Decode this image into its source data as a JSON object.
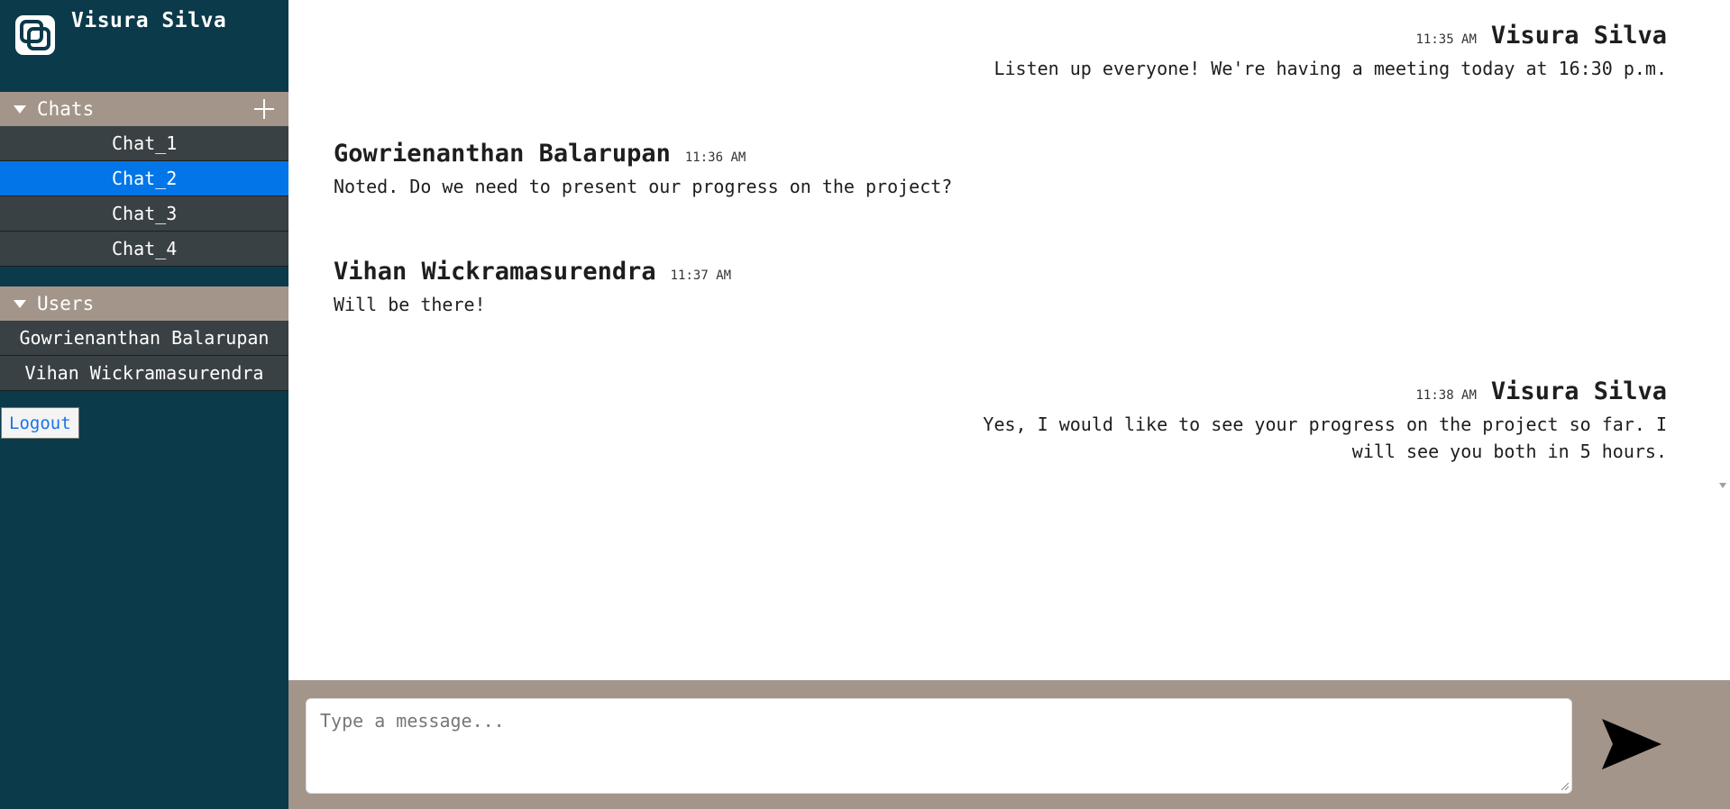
{
  "sidebar": {
    "username": "Visura Silva",
    "chats_header": "Chats",
    "chats": [
      {
        "label": "Chat_1"
      },
      {
        "label": "Chat_2",
        "active": true
      },
      {
        "label": "Chat_3"
      },
      {
        "label": "Chat_4"
      }
    ],
    "users_header": "Users",
    "users": [
      {
        "label": "Gowrienanthan Balarupan"
      },
      {
        "label": "Vihan Wickramasurendra"
      }
    ],
    "logout_label": "Logout"
  },
  "messages": [
    {
      "sender": "Visura Silva",
      "time": "11:35 AM",
      "text": "Listen up everyone! We're having a meeting today at 16:30 p.m.",
      "align": "right"
    },
    {
      "sender": "Gowrienanthan Balarupan",
      "time": "11:36 AM",
      "text": "Noted. Do we need to present our progress on the project?",
      "align": "left"
    },
    {
      "sender": "Vihan Wickramasurendra",
      "time": "11:37 AM",
      "text": "Will be there!",
      "align": "left"
    },
    {
      "sender": "Visura Silva",
      "time": "11:38 AM",
      "text": "Yes, I would like to see your progress on the project so far. I will see you both in 5 hours.",
      "align": "right"
    }
  ],
  "composer": {
    "placeholder": "Type a message...",
    "value": ""
  },
  "icons": {
    "logo": "app-logo-icon",
    "add": "plus-icon",
    "send": "send-icon",
    "caret": "caret-down-icon"
  },
  "colors": {
    "sidebar_bg": "#0b3a4a",
    "section_header_bg": "#a39589",
    "item_bg": "#394144",
    "active_item_bg": "#0275e8",
    "composer_bg": "#a39589"
  }
}
